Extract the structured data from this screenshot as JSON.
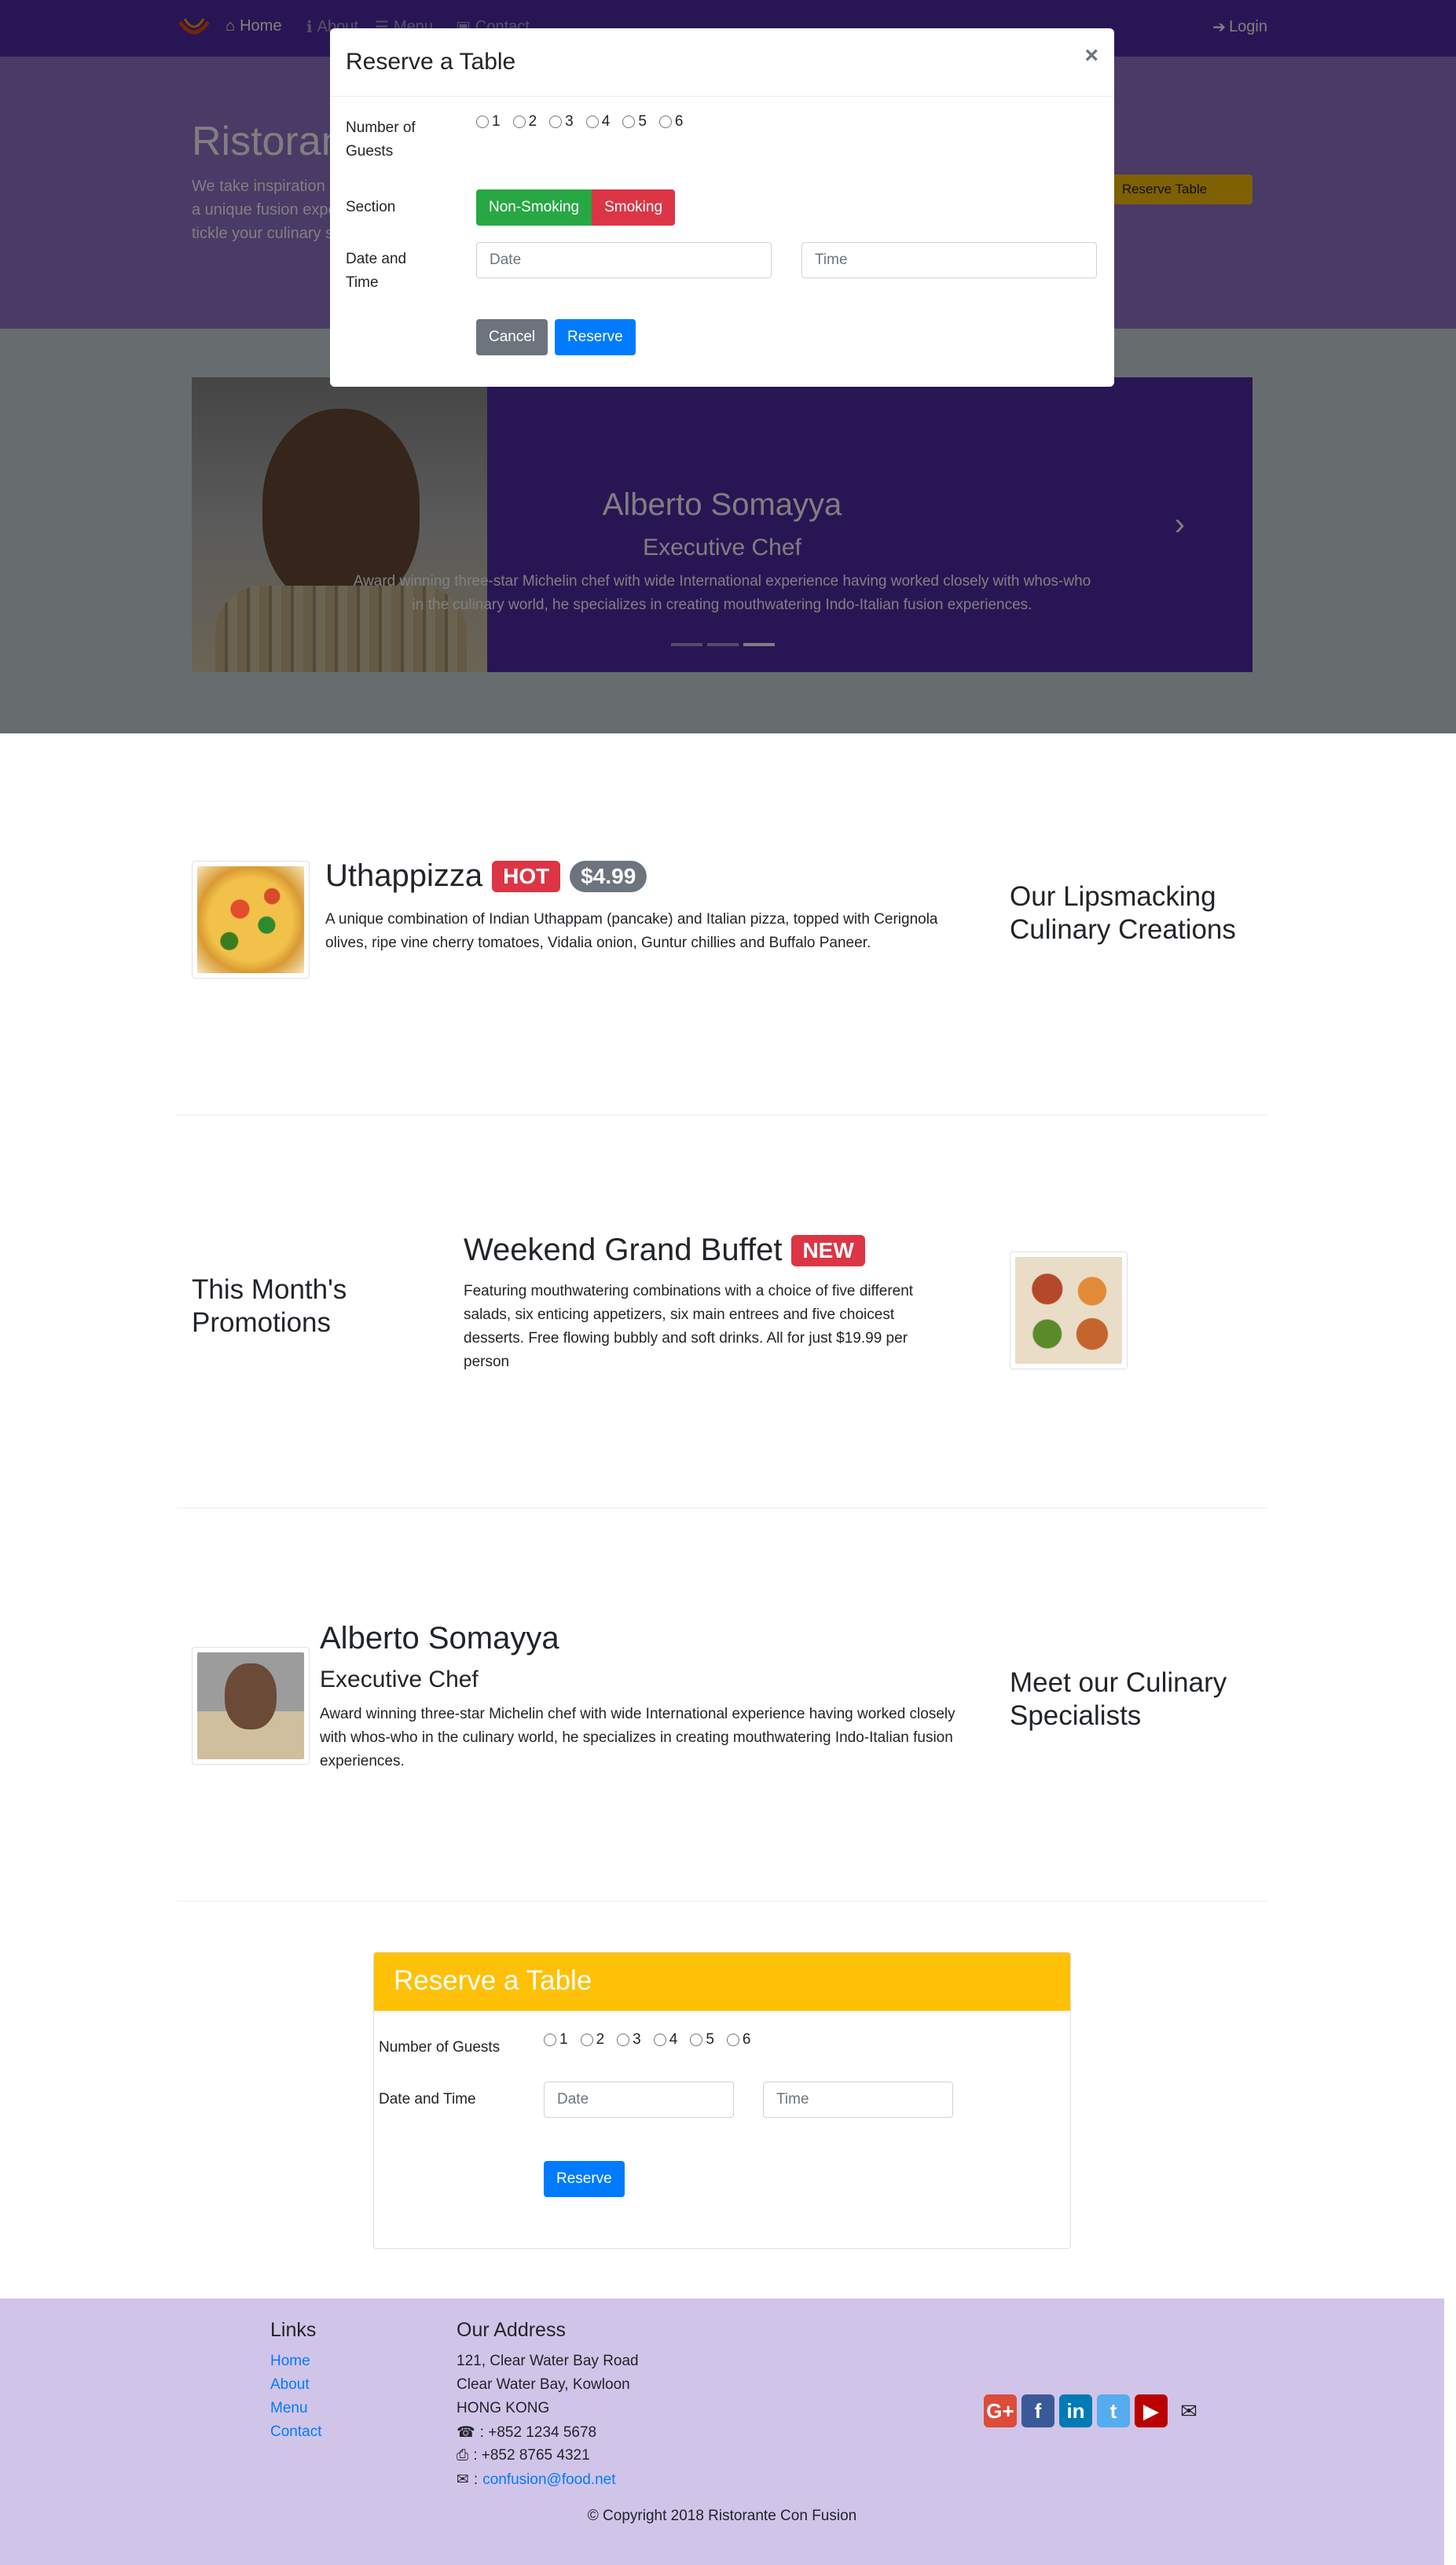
{
  "navbar": {
    "items": [
      {
        "label": "Home",
        "icon": "home-icon"
      },
      {
        "label": "About",
        "icon": "info-icon"
      },
      {
        "label": "Menu",
        "icon": "list-icon"
      },
      {
        "label": "Contact",
        "icon": "address-card-icon"
      }
    ],
    "login": "Login"
  },
  "jumbotron": {
    "title": "Ristorante con Fusion",
    "text": "We take inspiration from the World's best cuisines, and create a unique fusion experience. Our lipsmacking creations will tickle your culinary senses!",
    "button": "Reserve Table"
  },
  "carousel": {
    "name": "Alberto Somayya",
    "role": "Executive Chef",
    "description": "Award winning three-star Michelin chef with wide International experience having worked closely with whos-who in the culinary world, he specializes in creating mouthwatering Indo-Italian fusion experiences."
  },
  "modal": {
    "title": "Reserve a Table",
    "close": "×",
    "guests_label": "Number of Guests",
    "guests": [
      "1",
      "2",
      "3",
      "4",
      "5",
      "6"
    ],
    "section_label": "Section",
    "section_options": [
      "Non-Smoking",
      "Smoking"
    ],
    "datetime_label": "Date and Time",
    "date_placeholder": "Date",
    "time_placeholder": "Time",
    "cancel": "Cancel",
    "reserve": "Reserve"
  },
  "dish": {
    "name": "Uthappizza",
    "badge": "HOT",
    "price": "$4.99",
    "description": "A unique combination of Indian Uthappam (pancake) and Italian pizza, topped with Cerignola olives, ripe vine cherry tomatoes, Vidalia onion, Guntur chillies and Buffalo Paneer.",
    "side_heading": "Our Lipsmacking Culinary Creations"
  },
  "promotion": {
    "side_heading": "This Month's Promotions",
    "name": "Weekend Grand Buffet",
    "badge": "NEW",
    "description": "Featuring mouthwatering combinations with a choice of five different salads, six enticing appetizers, six main entrees and five choicest desserts. Free flowing bubbly and soft drinks. All for just $19.99 per person"
  },
  "leader": {
    "name": "Alberto Somayya",
    "role": "Executive Chef",
    "description": "Award winning three-star Michelin chef with wide International experience having worked closely with whos-who in the culinary world, he specializes in creating mouthwatering Indo-Italian fusion experiences.",
    "side_heading": "Meet our Culinary Specialists"
  },
  "reserve_card": {
    "title": "Reserve a Table",
    "guests_label": "Number of Guests",
    "guests": [
      "1",
      "2",
      "3",
      "4",
      "5",
      "6"
    ],
    "datetime_label": "Date and Time",
    "date_placeholder": "Date",
    "time_placeholder": "Time",
    "reserve": "Reserve"
  },
  "footer": {
    "links_heading": "Links",
    "links": [
      "Home",
      "About",
      "Menu",
      "Contact"
    ],
    "address_heading": "Our Address",
    "address": [
      "121, Clear Water Bay Road",
      "Clear Water Bay, Kowloon",
      "HONG KONG"
    ],
    "phone": ": +852 1234 5678",
    "fax": ": +852 8765 4321",
    "email": "confusion@food.net",
    "social": [
      {
        "icon": "google-plus-icon",
        "glyph": "G+",
        "color": "#DD4B39"
      },
      {
        "icon": "facebook-icon",
        "glyph": "f",
        "color": "#3B5998"
      },
      {
        "icon": "linkedin-icon",
        "glyph": "in",
        "color": "#007BB6"
      },
      {
        "icon": "twitter-icon",
        "glyph": "t",
        "color": "#55ACEE"
      },
      {
        "icon": "youtube-icon",
        "glyph": "▶",
        "color": "#BB0000"
      },
      {
        "icon": "envelope-icon",
        "glyph": "✉",
        "color": "#212529"
      }
    ],
    "copyright": "© Copyright 2018 Ristorante Con Fusion"
  },
  "colors": {
    "primary": "#512DA8",
    "light": "#9575CD",
    "footer": "#D1C4E9",
    "warning": "#FFC107",
    "success": "#28A745",
    "danger": "#DC3545",
    "info": "#007BFF"
  }
}
